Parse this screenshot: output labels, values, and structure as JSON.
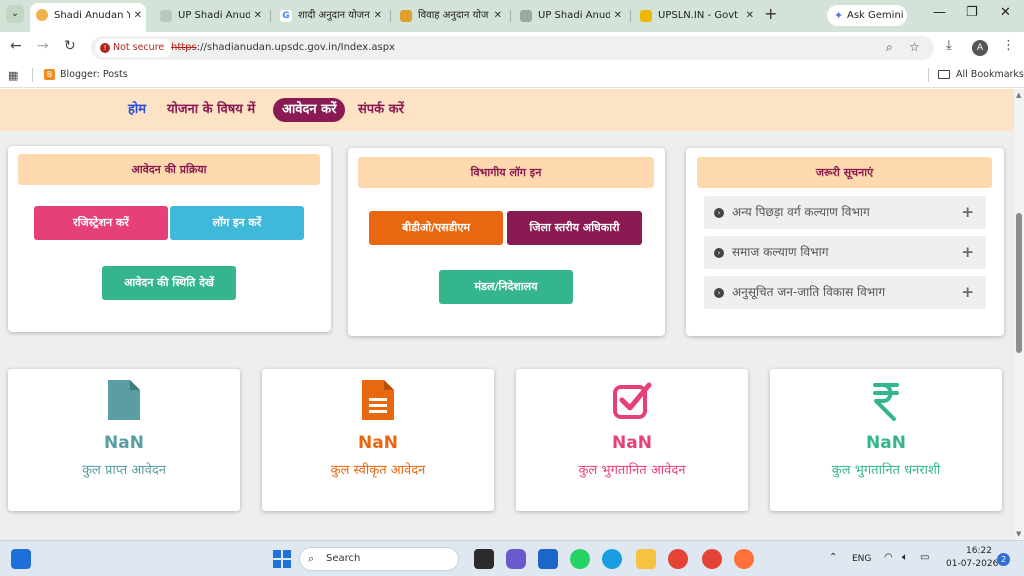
{
  "browser": {
    "tabs": [
      {
        "label": "Shadi Anudan Yo",
        "active": true
      },
      {
        "label": "UP Shadi Anudan"
      },
      {
        "label": "शादी अनुदान योजना"
      },
      {
        "label": "विवाह अनुदान योज"
      },
      {
        "label": "UP Shadi Anudan"
      },
      {
        "label": "UPSLN.IN - Govt"
      }
    ],
    "ask_gemini": "Ask Gemini",
    "not_secure": "Not secure",
    "url_scheme": "https",
    "url_rest": "://shadianudan.upsdc.gov.in/Index.aspx",
    "bookmark_blogger": "Blogger: Posts",
    "all_bookmarks": "All Bookmarks",
    "profile_initial": "A"
  },
  "site_nav": {
    "home": "होम",
    "about": "योजना के विषय में",
    "apply": "आवेदन करें",
    "contact": "संपर्क करें"
  },
  "process_panel": {
    "title": "आवेदन की प्रक्रिया",
    "register": "रजिस्ट्रेशन करें",
    "login": "लॉग इन करें",
    "status": "आवेदन की स्थिति देखें"
  },
  "dept_panel": {
    "title": "विभागीय लॉग इन",
    "bdo": "बीडीओ/एसडीएम",
    "district": "जिला स्तरीय अधिकारी",
    "division": "मंडल/निदेशालय"
  },
  "notices_panel": {
    "title": "जरूरी सूचनाएं",
    "items": [
      "अन्य पिछड़ा वर्ग कल्याण विभाग",
      "समाज कल्याण विभाग",
      "अनुसूचित जन-जाति विकास विभाग"
    ]
  },
  "stats": [
    {
      "value": "NaN",
      "label": "कुल प्राप्त आवेदन",
      "color": "#5a9ea3",
      "icon": "document-icon"
    },
    {
      "value": "NaN",
      "label": "कुल स्वीकृत आवेदन",
      "color": "#e8670f",
      "icon": "file-text-icon"
    },
    {
      "value": "NaN",
      "label": "कुल भुगतानित आवेदन",
      "color": "#e63f7a",
      "icon": "checkbox-icon"
    },
    {
      "value": "NaN",
      "label": "कुल भुगतानित धनराशी",
      "color": "#35b58e",
      "icon": "rupee-icon"
    }
  ],
  "taskbar": {
    "search": "Search",
    "lang": "ENG",
    "time": "16:22",
    "date": "01-07-2026",
    "notifications": "2"
  }
}
